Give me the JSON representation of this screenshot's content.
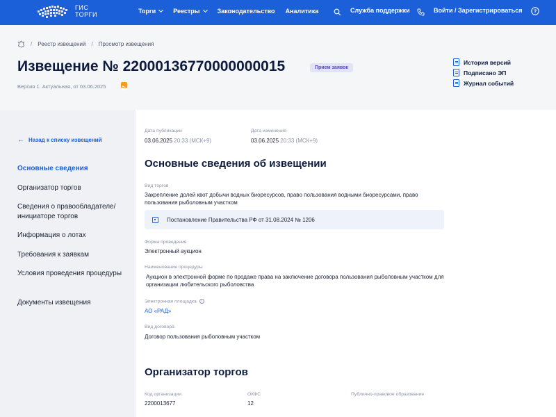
{
  "header": {
    "logo_line1": "ГИС",
    "logo_line2": "ТОРГИ",
    "nav": [
      {
        "label": "Торги"
      },
      {
        "label": "Реестры"
      },
      {
        "label": "Законодательство"
      },
      {
        "label": "Аналитика"
      }
    ],
    "support_label": "Служба поддержки",
    "login_label": "Войти / Зарегистрироваться"
  },
  "breadcrumb": {
    "items": [
      "Реестр извещений",
      "Просмотр извещения"
    ]
  },
  "notice": {
    "title": "Извещение № 22000136770000000015",
    "status_badge": "Прием заявок",
    "version": "Версия 1. Актуальная, от 03.06.2025"
  },
  "side_links": [
    "История версий",
    "Подписано ЭП",
    "Журнал событий"
  ],
  "sidebar": {
    "back_label": "Назад к списку извещений",
    "menu": [
      {
        "label": "Основные сведения",
        "active": true
      },
      {
        "label": "Организатор торгов"
      },
      {
        "label": "Сведения о правообладателе/ инициаторе торгов"
      },
      {
        "label": "Информация о лотах"
      },
      {
        "label": "Требования к заявкам"
      },
      {
        "label": "Условия проведения процедуры"
      },
      {
        "label": "Документы извещения"
      }
    ]
  },
  "dates": {
    "published_label": "Дата публикации",
    "published_date": "03.06.2025",
    "published_time": "20:33 (МСК+9)",
    "changed_label": "Дата изменения",
    "changed_date": "03.06.2025",
    "changed_time": "20:33 (МСК+9)"
  },
  "basic_info": {
    "title": "Основные сведения об извещении",
    "auction_type_label": "Вид торгов",
    "auction_type_value": "Закрепление долей квот добычи водных биоресурсов, право пользования водными биоресурсами, право пользования рыболовным участком",
    "regulation_link": "Постановление Правительства РФ от 31.08.2024 № 1206",
    "form_label": "Форма проведения",
    "form_value": "Электронный аукцион",
    "procedure_label": "Наименование процедуры",
    "procedure_value": "Аукцион в электронной форме по продаже права на заключение договора пользования рыболовным участком для организации любительского рыболовства",
    "platform_label": "Электронная площадка",
    "platform_value": "АО «РАД»",
    "contract_label": "Вид договора",
    "contract_value": "Договор пользования рыболовным участком"
  },
  "organizer": {
    "title": "Организатор торгов",
    "code_label": "Код организации",
    "code_value": "2200013677",
    "okfs_label": "ОКФС",
    "okfs_value": "12",
    "public_entity_label": "Публично-правовое образование"
  },
  "colors": {
    "brand_blue": "#1b5fd9",
    "badge_bg": "#e3e3f7",
    "badge_text": "#5346c6"
  }
}
